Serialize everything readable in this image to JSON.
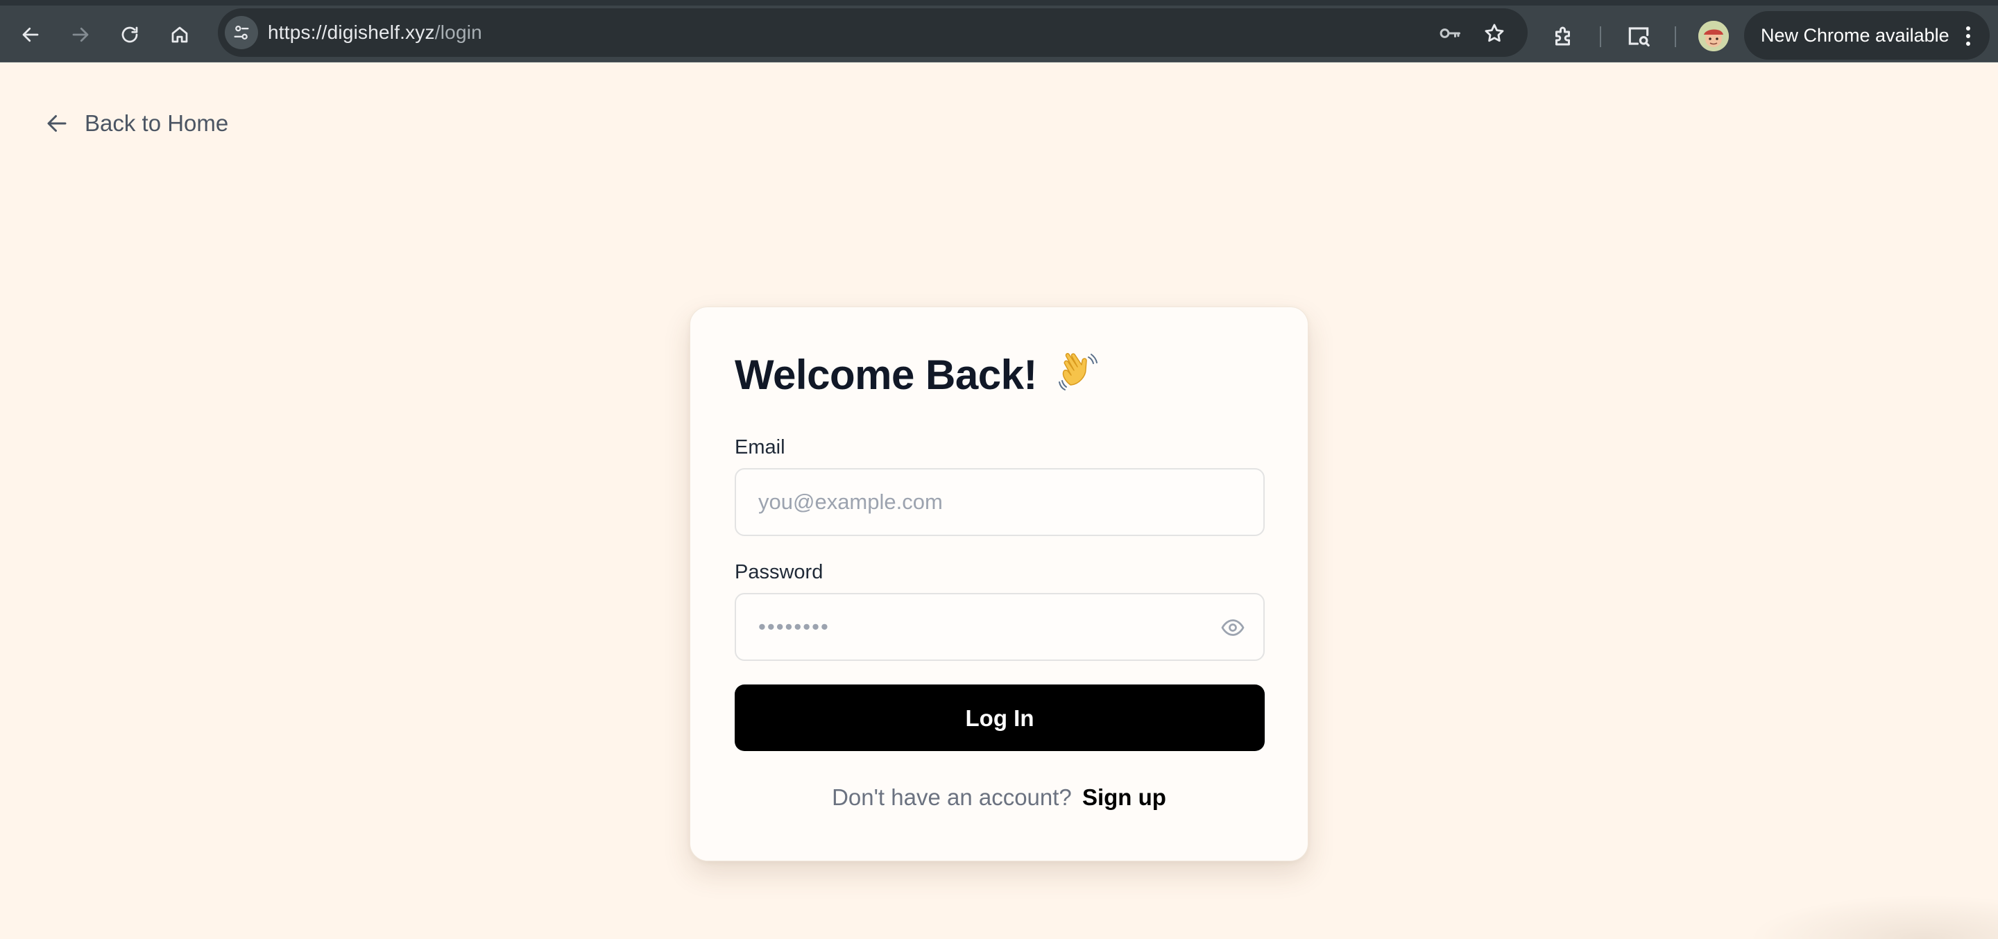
{
  "browser": {
    "url_host": "https://digishelf.xyz",
    "url_path": "/login",
    "update_button_label": "New Chrome available"
  },
  "page": {
    "back_link_label": "Back to Home"
  },
  "login_card": {
    "title": "Welcome Back!",
    "title_emoji": "waving-hand",
    "email_label": "Email",
    "email_placeholder": "you@example.com",
    "password_label": "Password",
    "password_placeholder": "••••••••",
    "login_button_label": "Log In",
    "signup_prompt": "Don't have an account?",
    "signup_link_label": "Sign up"
  },
  "colors": {
    "page_background": "#fff5eb",
    "card_background": "#fffcf9",
    "primary_button": "#000000",
    "browser_toolbar": "#3c4449"
  }
}
